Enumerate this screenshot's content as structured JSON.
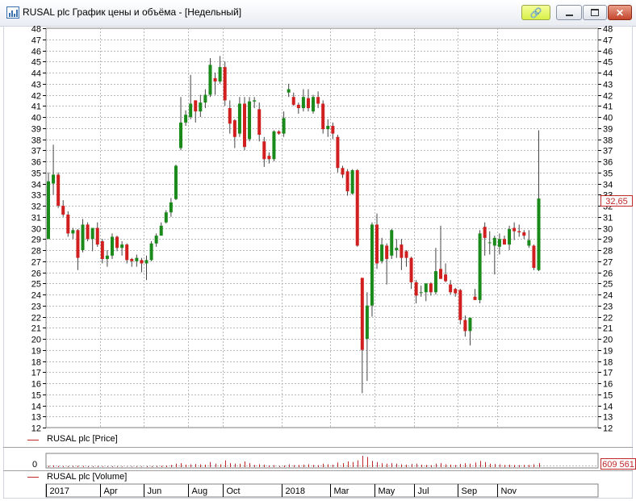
{
  "window": {
    "title": "RUSAL plc График цены и объёма - [Недельный]",
    "icons": [
      "chart-app-icon",
      "link-icon",
      "minimize-icon",
      "maximize-icon",
      "close-icon"
    ]
  },
  "price_panel": {
    "legend": "RUSAL plc [Price]",
    "last_value": "32,65",
    "colors": {
      "up": "#1a8a1a",
      "down": "#d11f1f",
      "grid": "#b8b8b8",
      "wick": "#444444",
      "marker": "#c0282a"
    }
  },
  "volume_panel": {
    "legend": "RUSAL plc [Volume]",
    "zero_label": "0",
    "last_value": "609 561"
  },
  "chart_data": {
    "type": "candlestick",
    "period": "weekly",
    "ylim": [
      12,
      48
    ],
    "yticks": [
      12,
      13,
      14,
      15,
      16,
      17,
      18,
      19,
      20,
      21,
      22,
      23,
      24,
      25,
      26,
      27,
      28,
      29,
      30,
      31,
      32,
      33,
      34,
      35,
      36,
      37,
      38,
      39,
      40,
      41,
      42,
      43,
      44,
      45,
      46,
      47,
      48
    ],
    "grid": true,
    "x_tick_labels": [
      "2017",
      "Apr",
      "Jun",
      "Aug",
      "Oct",
      "2018",
      "Mar",
      "May",
      "Jul",
      "Sep",
      "Nov"
    ],
    "x_tick_index": [
      0,
      11,
      20,
      29,
      36,
      48,
      58,
      67,
      75,
      84,
      92
    ],
    "series": [
      {
        "name": "RUSAL plc [Price]",
        "ohlc": [
          [
            29,
            35,
            29,
            34.2
          ],
          [
            34,
            37.5,
            33,
            34.8
          ],
          [
            34.8,
            35,
            31.8,
            32
          ],
          [
            32,
            32.5,
            31,
            31.2
          ],
          [
            31.2,
            31.5,
            29.2,
            29.5
          ],
          [
            29.5,
            30,
            29,
            29.8
          ],
          [
            29.8,
            29.9,
            26.2,
            27.3
          ],
          [
            28,
            30.8,
            27.8,
            30.3
          ],
          [
            30.3,
            30.5,
            28.8,
            29
          ],
          [
            29,
            30,
            27.9,
            30
          ],
          [
            30,
            30.5,
            28.3,
            28.5
          ],
          [
            28.8,
            29,
            26.8,
            27.2
          ],
          [
            27.2,
            28,
            26.5,
            27.5
          ],
          [
            27.5,
            29.5,
            27.2,
            29.2
          ],
          [
            29.2,
            29.3,
            27.9,
            28.2
          ],
          [
            28.2,
            28.8,
            27.5,
            28.5
          ],
          [
            28.5,
            28.6,
            26.8,
            27.1
          ],
          [
            27.2,
            27.3,
            26.5,
            27
          ],
          [
            27,
            27.6,
            26.5,
            27.3
          ],
          [
            27.1,
            27.3,
            26,
            26.8
          ],
          [
            26.8,
            27.5,
            25.3,
            27.1
          ],
          [
            27.1,
            28.8,
            27,
            28.6
          ],
          [
            28.6,
            29.5,
            28.3,
            29.3
          ],
          [
            29.3,
            30.5,
            29.3,
            30.2
          ],
          [
            30.5,
            31.6,
            30.4,
            31.4
          ],
          [
            31.4,
            32.7,
            31,
            32.3
          ],
          [
            32.6,
            35.7,
            32.5,
            35.6
          ],
          [
            37.2,
            41.8,
            37,
            39.5
          ],
          [
            39.5,
            40.6,
            39.2,
            40.2
          ],
          [
            40,
            43.8,
            39.8,
            41.2
          ],
          [
            41.5,
            41.5,
            39.5,
            40.5
          ],
          [
            40.5,
            42,
            40,
            41.3
          ],
          [
            41.3,
            42.5,
            40.8,
            42
          ],
          [
            42,
            45.3,
            41.8,
            44.7
          ],
          [
            43.5,
            44,
            42,
            43.2
          ],
          [
            43.2,
            45.5,
            43,
            44.5
          ],
          [
            44.5,
            45,
            41,
            41.5
          ],
          [
            40.8,
            41.5,
            38.5,
            39.4
          ],
          [
            39.7,
            39.8,
            37.2,
            38.2
          ],
          [
            38.5,
            41.8,
            38.2,
            41.2
          ],
          [
            41.2,
            41.8,
            37,
            37.3
          ],
          [
            38,
            41.8,
            37.8,
            41.4
          ],
          [
            41.4,
            41.8,
            40.8,
            41.5
          ],
          [
            40.7,
            41.3,
            37.8,
            38.4
          ],
          [
            37.8,
            38.2,
            35.5,
            36.2
          ],
          [
            36.5,
            36.8,
            35.8,
            36.2
          ],
          [
            36.2,
            38.8,
            36,
            38.7
          ],
          [
            38.7,
            38.8,
            38.4,
            38.5
          ],
          [
            38.5,
            40.5,
            38.2,
            39.9
          ],
          [
            42.2,
            43,
            41.8,
            42.5
          ],
          [
            41.8,
            42.2,
            41,
            41.1
          ],
          [
            41.1,
            41.3,
            40.3,
            40.8
          ],
          [
            40.8,
            42.5,
            40.5,
            41.8
          ],
          [
            41.7,
            42.5,
            40.5,
            40.8
          ],
          [
            40.5,
            42,
            40.3,
            41.8
          ],
          [
            41.8,
            42.3,
            40.8,
            41.2
          ],
          [
            41.2,
            41.5,
            38.5,
            38.9
          ],
          [
            38.9,
            39.8,
            38.2,
            39.2
          ],
          [
            39.2,
            39.5,
            38,
            38.5
          ],
          [
            38.2,
            38.4,
            35,
            35.4
          ],
          [
            35.4,
            35.6,
            34.5,
            34.8
          ],
          [
            35.1,
            35.3,
            32.9,
            33.3
          ],
          [
            33.1,
            35.3,
            33,
            35.2
          ],
          [
            35.2,
            35.3,
            28.3,
            28.4
          ],
          [
            25.5,
            25.5,
            15.1,
            19
          ],
          [
            20,
            24.2,
            16.2,
            23
          ],
          [
            23,
            30.5,
            22,
            30.3
          ],
          [
            30.3,
            31.3,
            26.3,
            26.8
          ],
          [
            27,
            29.1,
            26.8,
            28.5
          ],
          [
            28.4,
            28.6,
            24.9,
            27.2
          ],
          [
            27.5,
            29.9,
            27.2,
            29.8
          ],
          [
            28,
            29,
            27.3,
            28.2
          ],
          [
            28.5,
            29,
            26.2,
            27.3
          ],
          [
            27.9,
            28,
            26.5,
            27.3
          ],
          [
            27.3,
            27.4,
            24.5,
            25.1
          ],
          [
            25.1,
            25.3,
            23.2,
            23.9
          ],
          [
            24.2,
            24.8,
            23.8,
            24.2
          ],
          [
            24.2,
            25,
            23.4,
            25
          ],
          [
            25,
            25.1,
            23.9,
            24.2
          ],
          [
            24.2,
            28.2,
            24,
            26.1
          ],
          [
            26.3,
            30.2,
            26,
            25.4
          ],
          [
            25.8,
            26.8,
            25.1,
            25.2
          ],
          [
            24.9,
            25.3,
            24,
            24.2
          ],
          [
            24.5,
            24.6,
            23.8,
            24.1
          ],
          [
            24.4,
            24.5,
            21.3,
            21.7
          ],
          [
            21.7,
            22.1,
            20.2,
            20.7
          ],
          [
            20.7,
            21.9,
            19.4,
            21.9
          ],
          [
            23.8,
            24.5,
            23.5,
            23.5
          ],
          [
            23.5,
            29.8,
            23.2,
            29.5
          ],
          [
            30.1,
            30.5,
            27.5,
            29.1
          ],
          [
            28.7,
            29.7,
            27.6,
            28.7
          ],
          [
            28.4,
            29.3,
            25.8,
            29.1
          ],
          [
            28.3,
            29.5,
            27.6,
            29
          ],
          [
            29,
            29.3,
            28.5,
            28.5
          ],
          [
            28.5,
            30.2,
            28,
            29.9
          ],
          [
            30,
            30.5,
            28.9,
            29.7
          ],
          [
            29.7,
            30.3,
            29.2,
            29.6
          ],
          [
            29.6,
            29.8,
            29,
            29.3
          ],
          [
            28.4,
            29.8,
            28.2,
            28.9
          ],
          [
            28.4,
            28.5,
            26.2,
            26.4
          ],
          [
            26.2,
            38.8,
            26.1,
            32.65
          ]
        ]
      },
      {
        "name": "RUSAL plc [Volume]",
        "values": [
          0.12,
          0.15,
          0.1,
          0.08,
          0.09,
          0.1,
          0.12,
          0.1,
          0.07,
          0.08,
          0.09,
          0.06,
          0.05,
          0.07,
          0.06,
          0.05,
          0.04,
          0.05,
          0.06,
          0.05,
          0.07,
          0.09,
          0.1,
          0.12,
          0.14,
          0.2,
          0.3,
          0.35,
          0.22,
          0.25,
          0.28,
          0.25,
          0.22,
          0.45,
          0.3,
          0.25,
          0.6,
          0.35,
          0.3,
          0.3,
          0.5,
          0.35,
          0.2,
          0.25,
          0.22,
          0.15,
          0.18,
          0.1,
          0.15,
          0.25,
          0.18,
          0.2,
          0.22,
          0.25,
          0.2,
          0.18,
          0.3,
          0.25,
          0.22,
          0.4,
          0.35,
          0.5,
          0.45,
          0.6,
          1.0,
          0.9,
          0.55,
          0.45,
          0.35,
          0.3,
          0.35,
          0.3,
          0.25,
          0.22,
          0.28,
          0.3,
          0.22,
          0.2,
          0.18,
          0.3,
          0.35,
          0.25,
          0.22,
          0.2,
          0.28,
          0.35,
          0.3,
          0.4,
          0.55,
          0.45,
          0.3,
          0.28,
          0.25,
          0.2,
          0.22,
          0.2,
          0.18,
          0.2,
          0.2,
          0.25,
          0.35
        ]
      }
    ]
  }
}
